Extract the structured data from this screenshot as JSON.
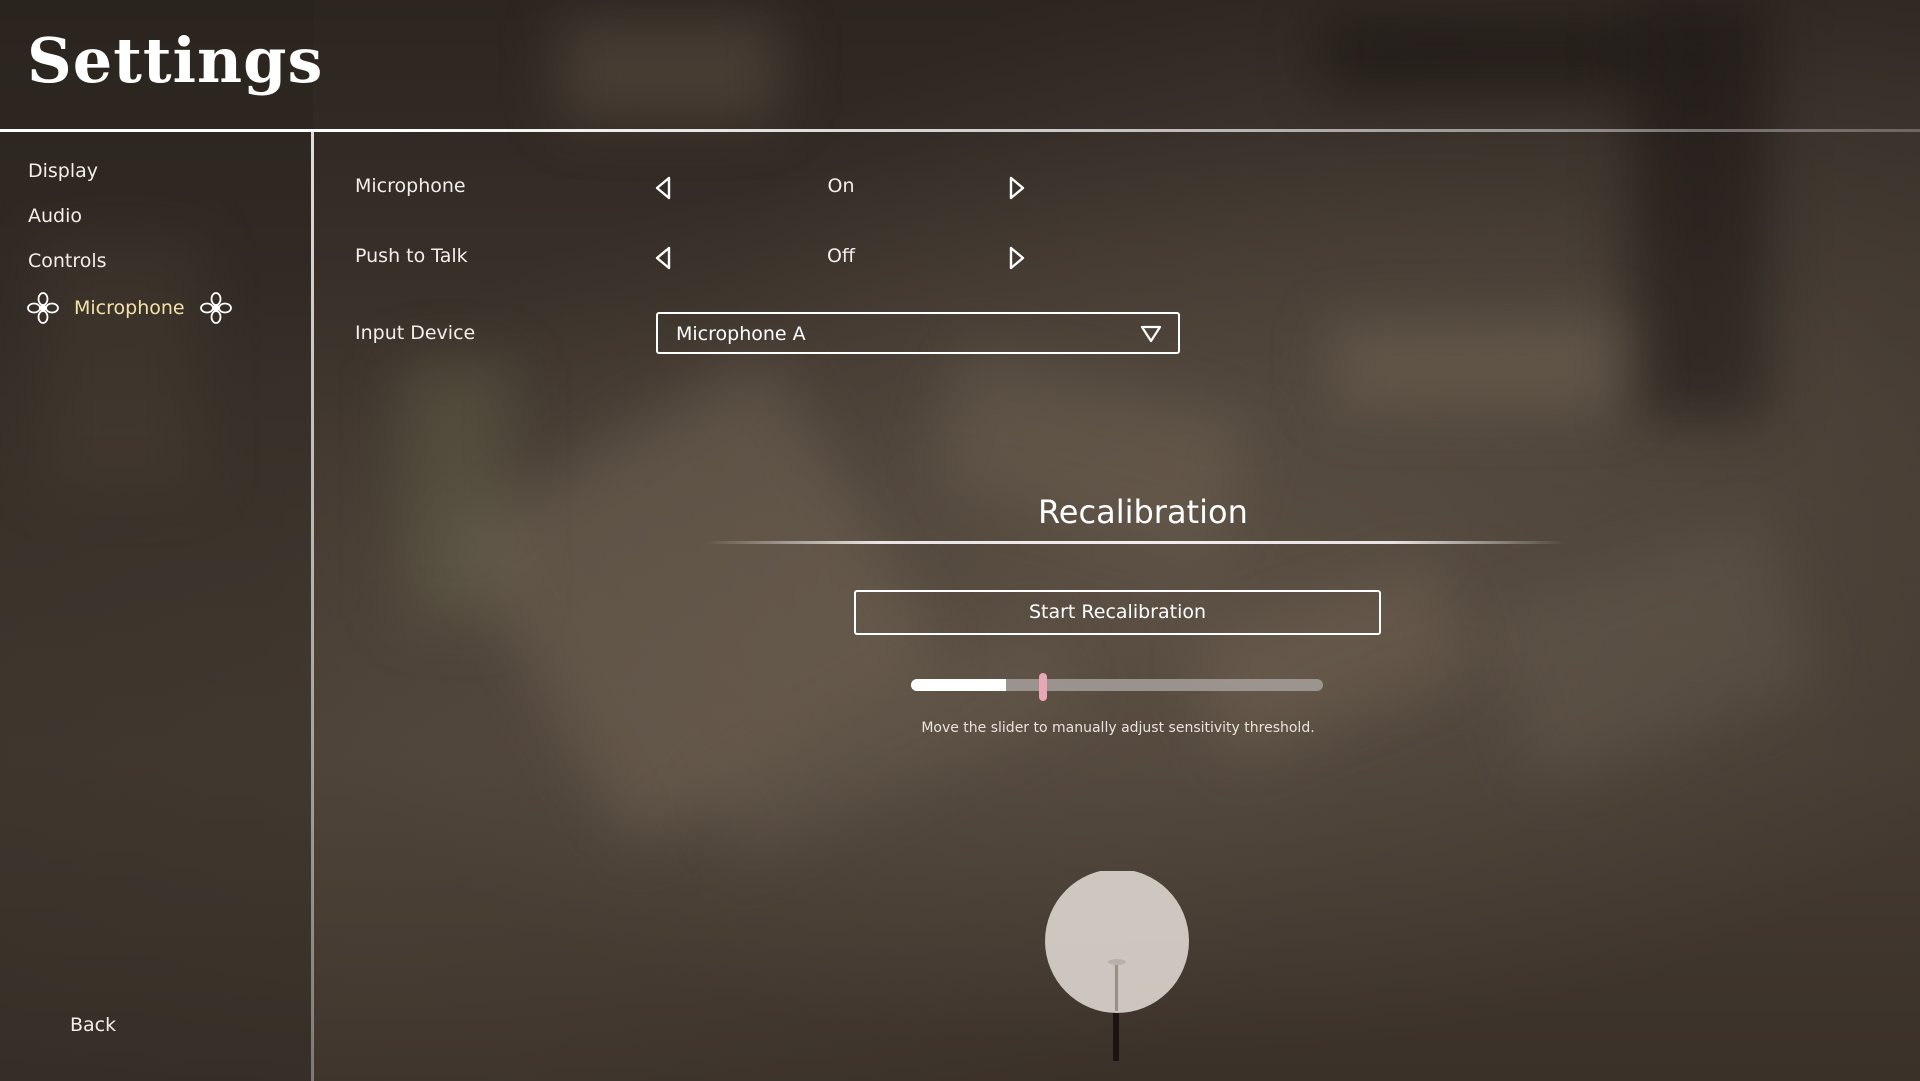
{
  "header": {
    "title": "Settings"
  },
  "sidebar": {
    "items": [
      {
        "label": "Display"
      },
      {
        "label": "Audio"
      },
      {
        "label": "Controls"
      },
      {
        "label": "Microphone",
        "selected": true
      }
    ],
    "back_label": "Back"
  },
  "settings": {
    "microphone": {
      "label": "Microphone",
      "value": "On"
    },
    "push_to_talk": {
      "label": "Push to Talk",
      "value": "Off"
    },
    "input_device": {
      "label": "Input Device",
      "value": "Microphone A"
    }
  },
  "recalibration": {
    "heading": "Recalibration",
    "button_label": "Start Recalibration",
    "slider": {
      "value_fraction": 0.32,
      "threshold_fraction": 0.23
    },
    "hint": "Move the slider to manually adjust sensitivity threshold."
  },
  "colors": {
    "accent_selected": "#f3e2a9",
    "slider_thumb": "#e7a7b4",
    "text": "#ffffff"
  },
  "icons": {
    "nav_ornament": "ornament-icon",
    "left_arrow": "triangle-left-icon",
    "right_arrow": "triangle-right-icon",
    "dropdown": "triangle-down-icon",
    "mic": "microphone-icon"
  }
}
